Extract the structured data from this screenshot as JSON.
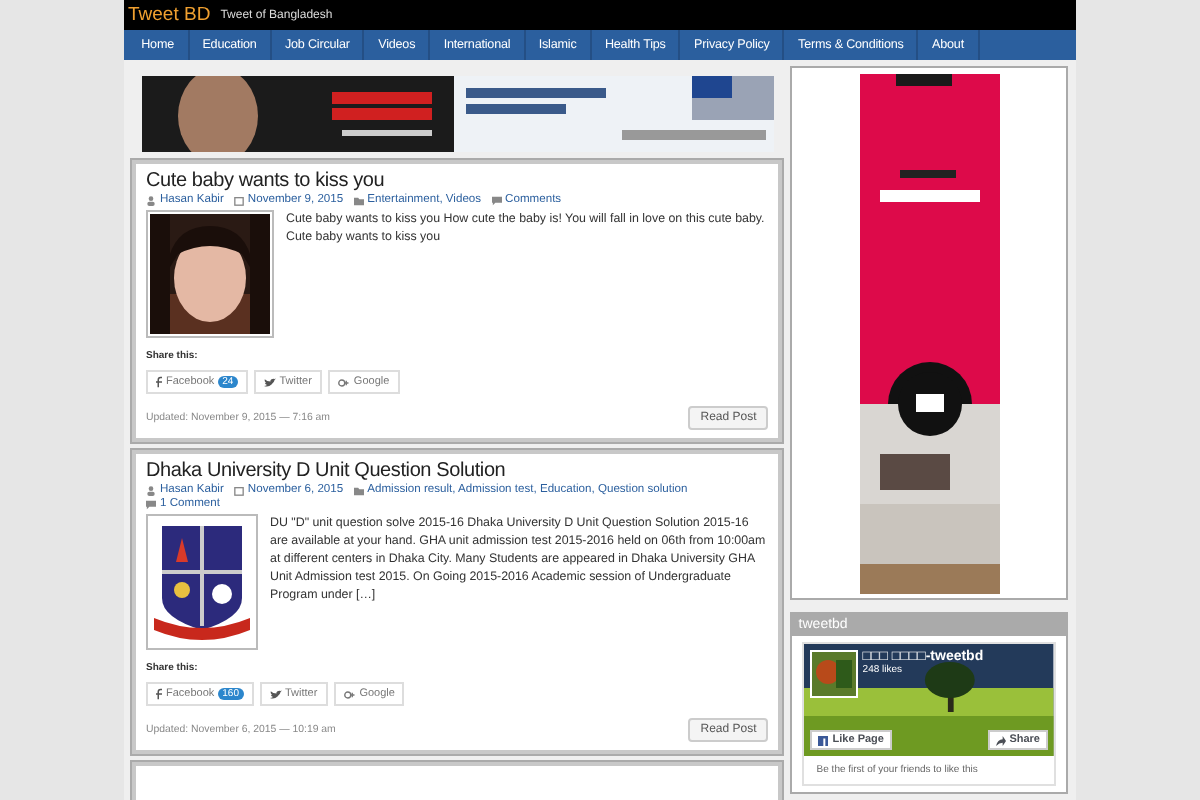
{
  "site": {
    "title": "Tweet BD",
    "tagline": "Tweet of Bangladesh"
  },
  "nav": [
    {
      "label": "Home"
    },
    {
      "label": "Education"
    },
    {
      "label": "Job Circular"
    },
    {
      "label": "Videos"
    },
    {
      "label": "International"
    },
    {
      "label": "Islamic"
    },
    {
      "label": "Health Tips"
    },
    {
      "label": "Privacy Policy"
    },
    {
      "label": "Terms & Conditions"
    },
    {
      "label": "About"
    }
  ],
  "posts": [
    {
      "title": "Cute baby wants to kiss you",
      "author": "Hasan Kabir",
      "date": "November 9, 2015",
      "categories": "Entertainment, Videos",
      "comments": "Comments",
      "excerpt": "Cute baby wants to kiss you How cute the baby is! You will fall in love on this cute baby. Cute baby wants to kiss you",
      "share_label": "Share this:",
      "share": [
        {
          "kind": "facebook",
          "label": "Facebook",
          "count": "24"
        },
        {
          "kind": "twitter",
          "label": "Twitter"
        },
        {
          "kind": "google",
          "label": "Google"
        }
      ],
      "updated": "Updated: November 9, 2015 — 7:16 am",
      "read_more": "Read Post"
    },
    {
      "title": "Dhaka University D Unit Question Solution",
      "author": "Hasan Kabir",
      "date": "November 6, 2015",
      "categories": "Admission result, Admission test, Education, Question solution",
      "comments": "1 Comment",
      "kind": "logo",
      "excerpt": "DU \"D\" unit question solve 2015-16 Dhaka University D Unit Question Solution 2015-16 are available at your hand.  GHA unit admission test 2015-2016 held on 06th from 10:00am at different centers in Dhaka City. Many Students are appeared in Dhaka University GHA Unit Admission test 2015. On Going 2015-2016 Academic session of Undergraduate Program under […]",
      "share_label": "Share this:",
      "share": [
        {
          "kind": "facebook",
          "label": "Facebook",
          "count": "160"
        },
        {
          "kind": "twitter",
          "label": "Twitter"
        },
        {
          "kind": "google",
          "label": "Google"
        }
      ],
      "updated": "Updated: November 6, 2015 — 10:19 am",
      "read_more": "Read Post"
    }
  ],
  "sidebar": {
    "widget_title": "tweetbd",
    "facebook": {
      "page_name": "□□□ □□□□-tweetbd",
      "likes": "248 likes",
      "like_button": "Like Page",
      "share_button": "Share",
      "friends_text": "Be the first of your friends to like this"
    }
  }
}
